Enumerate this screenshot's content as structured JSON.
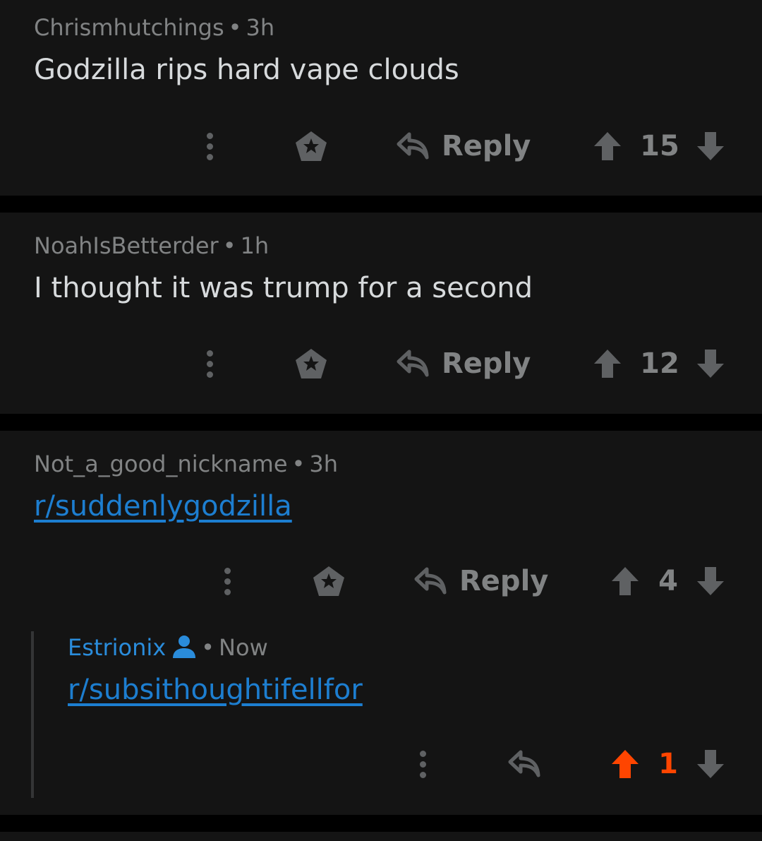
{
  "comments": [
    {
      "username": "Chrismhutchings",
      "separator": "•",
      "age": "3h",
      "body": "Godzilla rips hard vape clouds",
      "reply_label": "Reply",
      "score": "15"
    },
    {
      "username": "NoahIsBetterder",
      "separator": "•",
      "age": "1h",
      "body": "I thought it was trump for a second",
      "reply_label": "Reply",
      "score": "12"
    },
    {
      "username": "Not_a_good_nickname",
      "separator": "•",
      "age": "3h",
      "body": "r/suddenlygodzilla",
      "reply_label": "Reply",
      "score": "4",
      "reply": {
        "username": "Estrionix",
        "separator": "•",
        "age": "Now",
        "body": "r/subsithoughtifellfor",
        "score": "1",
        "vote_state": "upvoted"
      }
    }
  ],
  "colors": {
    "background": "#000000",
    "card": "#141414",
    "meta_text": "#818384",
    "body_text": "#d7dadc",
    "link": "#1d7ed0",
    "own_username": "#2a8cdb",
    "upvote_active": "#ff4500",
    "icon": "#5f6163"
  },
  "icons": [
    "more-options-icon",
    "award-icon",
    "reply-arrow-icon",
    "upvote-arrow-icon",
    "downvote-arrow-icon",
    "user-profile-icon"
  ]
}
